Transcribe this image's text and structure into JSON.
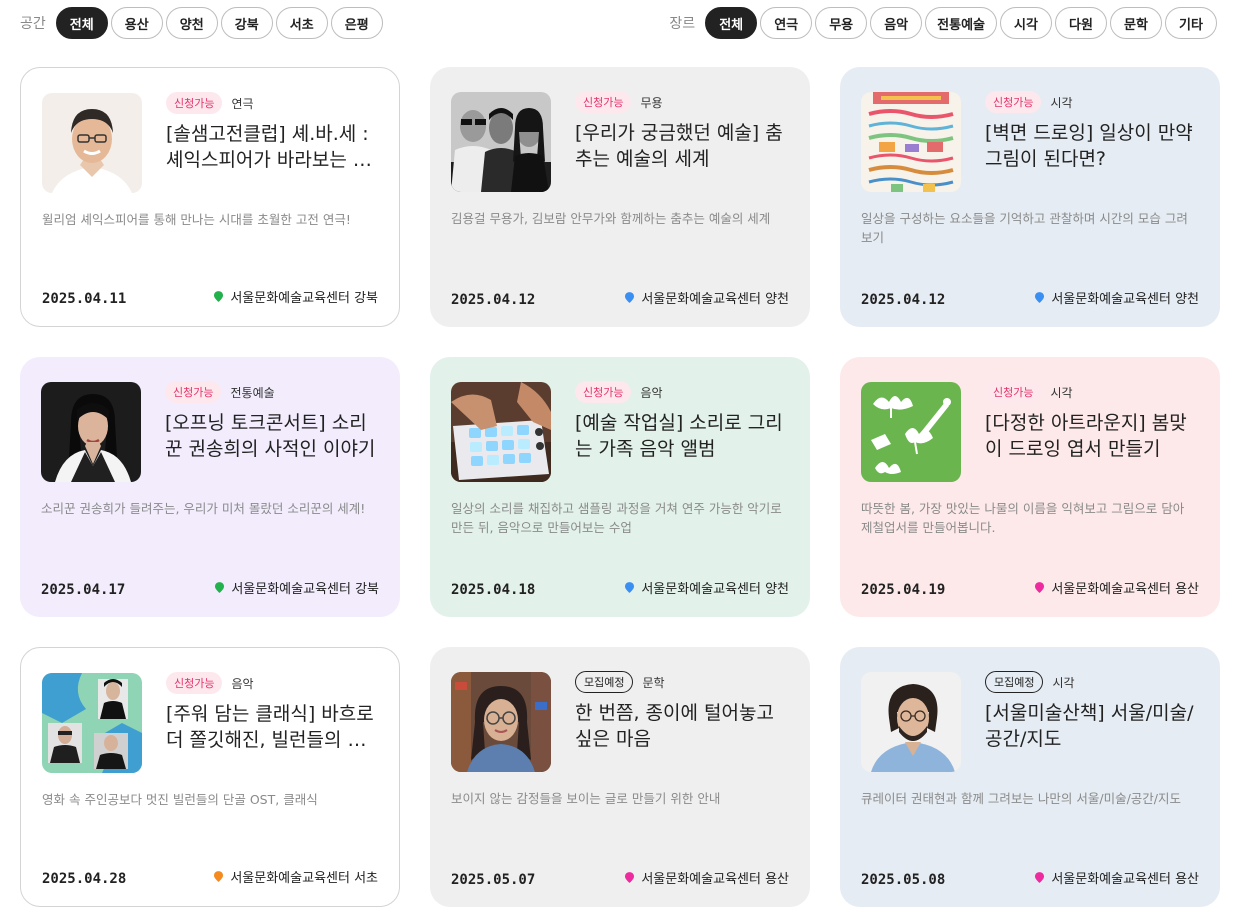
{
  "filters": {
    "space_label": "공간",
    "space_options": [
      "전체",
      "용산",
      "양천",
      "강북",
      "서초",
      "은평"
    ],
    "space_selected": "전체",
    "genre_label": "장르",
    "genre_options": [
      "전체",
      "연극",
      "무용",
      "음악",
      "전통예술",
      "시각",
      "다원",
      "문학",
      "기타"
    ],
    "genre_selected": "전체"
  },
  "location_colors": {
    "강북": "#22b14c",
    "양천": "#3b8ff2",
    "용산": "#ee2a9f",
    "서초": "#f58a1f"
  },
  "cards": [
    {
      "status": "신청가능",
      "genre": "연극",
      "title": "[솔샘고전클럽] 셰.바.세 : 셰익스피어가 바라보는 세상",
      "desc": "윌리엄 셰익스피어를 통해 만나는 시대를 초월한 고전 연극!",
      "date": "2025.04.11",
      "venue": "서울문화예술교육센터 강북",
      "image": "man-portrait"
    },
    {
      "status": "신청가능",
      "genre": "무용",
      "title": "[우리가 궁금했던 예술] 춤추는 예술의 세계",
      "desc": "김용걸 무용가, 김보람 안무가와 함께하는 춤추는 예술의 세계",
      "date": "2025.04.12",
      "venue": "서울문화예술교육센터 양천",
      "image": "three-dancers-photo"
    },
    {
      "status": "신청가능",
      "genre": "시각",
      "title": "[벽면 드로잉] 일상이 만약 그림이 된다면?",
      "desc": "일상을 구성하는 요소들을 기억하고 관찰하며 시간의 모습 그려보기",
      "date": "2025.04.12",
      "venue": "서울문화예술교육센터 양천",
      "image": "wall-drawing"
    },
    {
      "status": "신청가능",
      "genre": "전통예술",
      "title": "[오프닝 토크콘서트] 소리꾼 권송희의 사적인 이야기",
      "desc": "소리꾼 권송희가 들려주는, 우리가 미처 몰랐던 소리꾼의 세계!",
      "date": "2025.04.17",
      "venue": "서울문화예술교육센터 강북",
      "image": "woman-portrait"
    },
    {
      "status": "신청가능",
      "genre": "음악",
      "title": "[예술 작업실] 소리로 그리는 가족 음악 앨범",
      "desc": "일상의 소리를 채집하고 샘플링 과정을 거쳐 연주 가능한 악기로 만든 뒤, 음악으로 만들어보는 수업",
      "date": "2025.04.18",
      "venue": "서울문화예술교육센터 양천",
      "image": "sampler-pad"
    },
    {
      "status": "신청가능",
      "genre": "시각",
      "title": "[다정한 아트라운지] 봄맞이 드로잉 엽서 만들기",
      "desc": "따뜻한 봄, 가장 맛있는 나물의 이름을 익혀보고 그림으로 담아 제철업서를 만들어봅니다.",
      "date": "2025.04.19",
      "venue": "서울문화예술교육센터 용산",
      "image": "green-illustration"
    },
    {
      "status": "신청가능",
      "genre": "음악",
      "title": "[주워 담는 클래식] 바흐로 더 쫄깃해진, 빌런들의 클래식",
      "desc": "영화 속 주인공보다 멋진 빌런들의 단골 OST, 클래식",
      "date": "2025.04.28",
      "venue": "서울문화예술교육센터 서초",
      "image": "musicians-collage"
    },
    {
      "status": "모집예정",
      "genre": "문학",
      "title": "한 번쯤, 종이에 털어놓고 싶은 마음",
      "desc": "보이지 않는 감정들을 보이는 글로 만들기 위한 안내",
      "date": "2025.05.07",
      "venue": "서울문화예술교육센터 용산",
      "image": "woman-glasses"
    },
    {
      "status": "모집예정",
      "genre": "시각",
      "title": "[서울미술산책] 서울/미술/공간/지도",
      "desc": "큐레이터 권태현과 함께 그려보는 나만의 서울/미술/공간/지도",
      "date": "2025.05.08",
      "venue": "서울문화예술교육센터 용산",
      "image": "bearded-man"
    }
  ]
}
